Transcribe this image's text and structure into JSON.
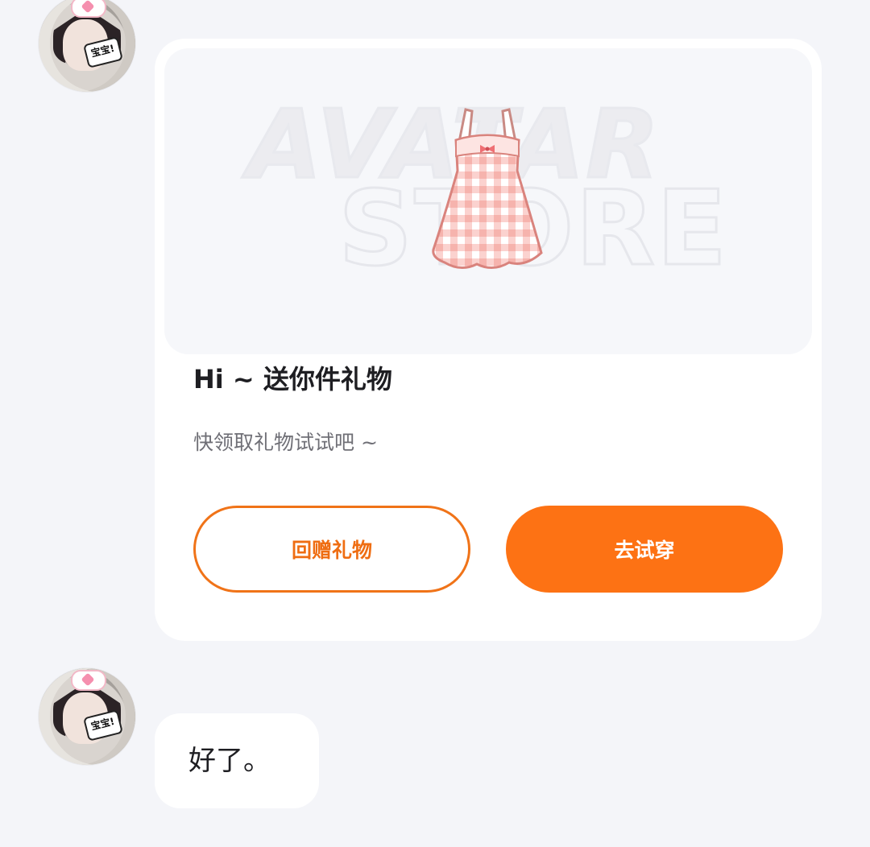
{
  "messages": [
    {
      "type": "gift_card",
      "banner_text": [
        "AVATAR",
        "STORE"
      ],
      "gift_icon": "checkered-dress-icon",
      "title": "Hi ~ 送你件礼物",
      "subtitle": "快领取礼物试试吧 ~",
      "buttons": {
        "return_gift": "回赠礼物",
        "try_on": "去试穿"
      },
      "colors": {
        "accent": "#fd7214",
        "outline": "#f07318"
      }
    },
    {
      "type": "text",
      "text": "好了。"
    }
  ],
  "avatar_sticker": "宝宝!",
  "background": "#f4f5f9"
}
